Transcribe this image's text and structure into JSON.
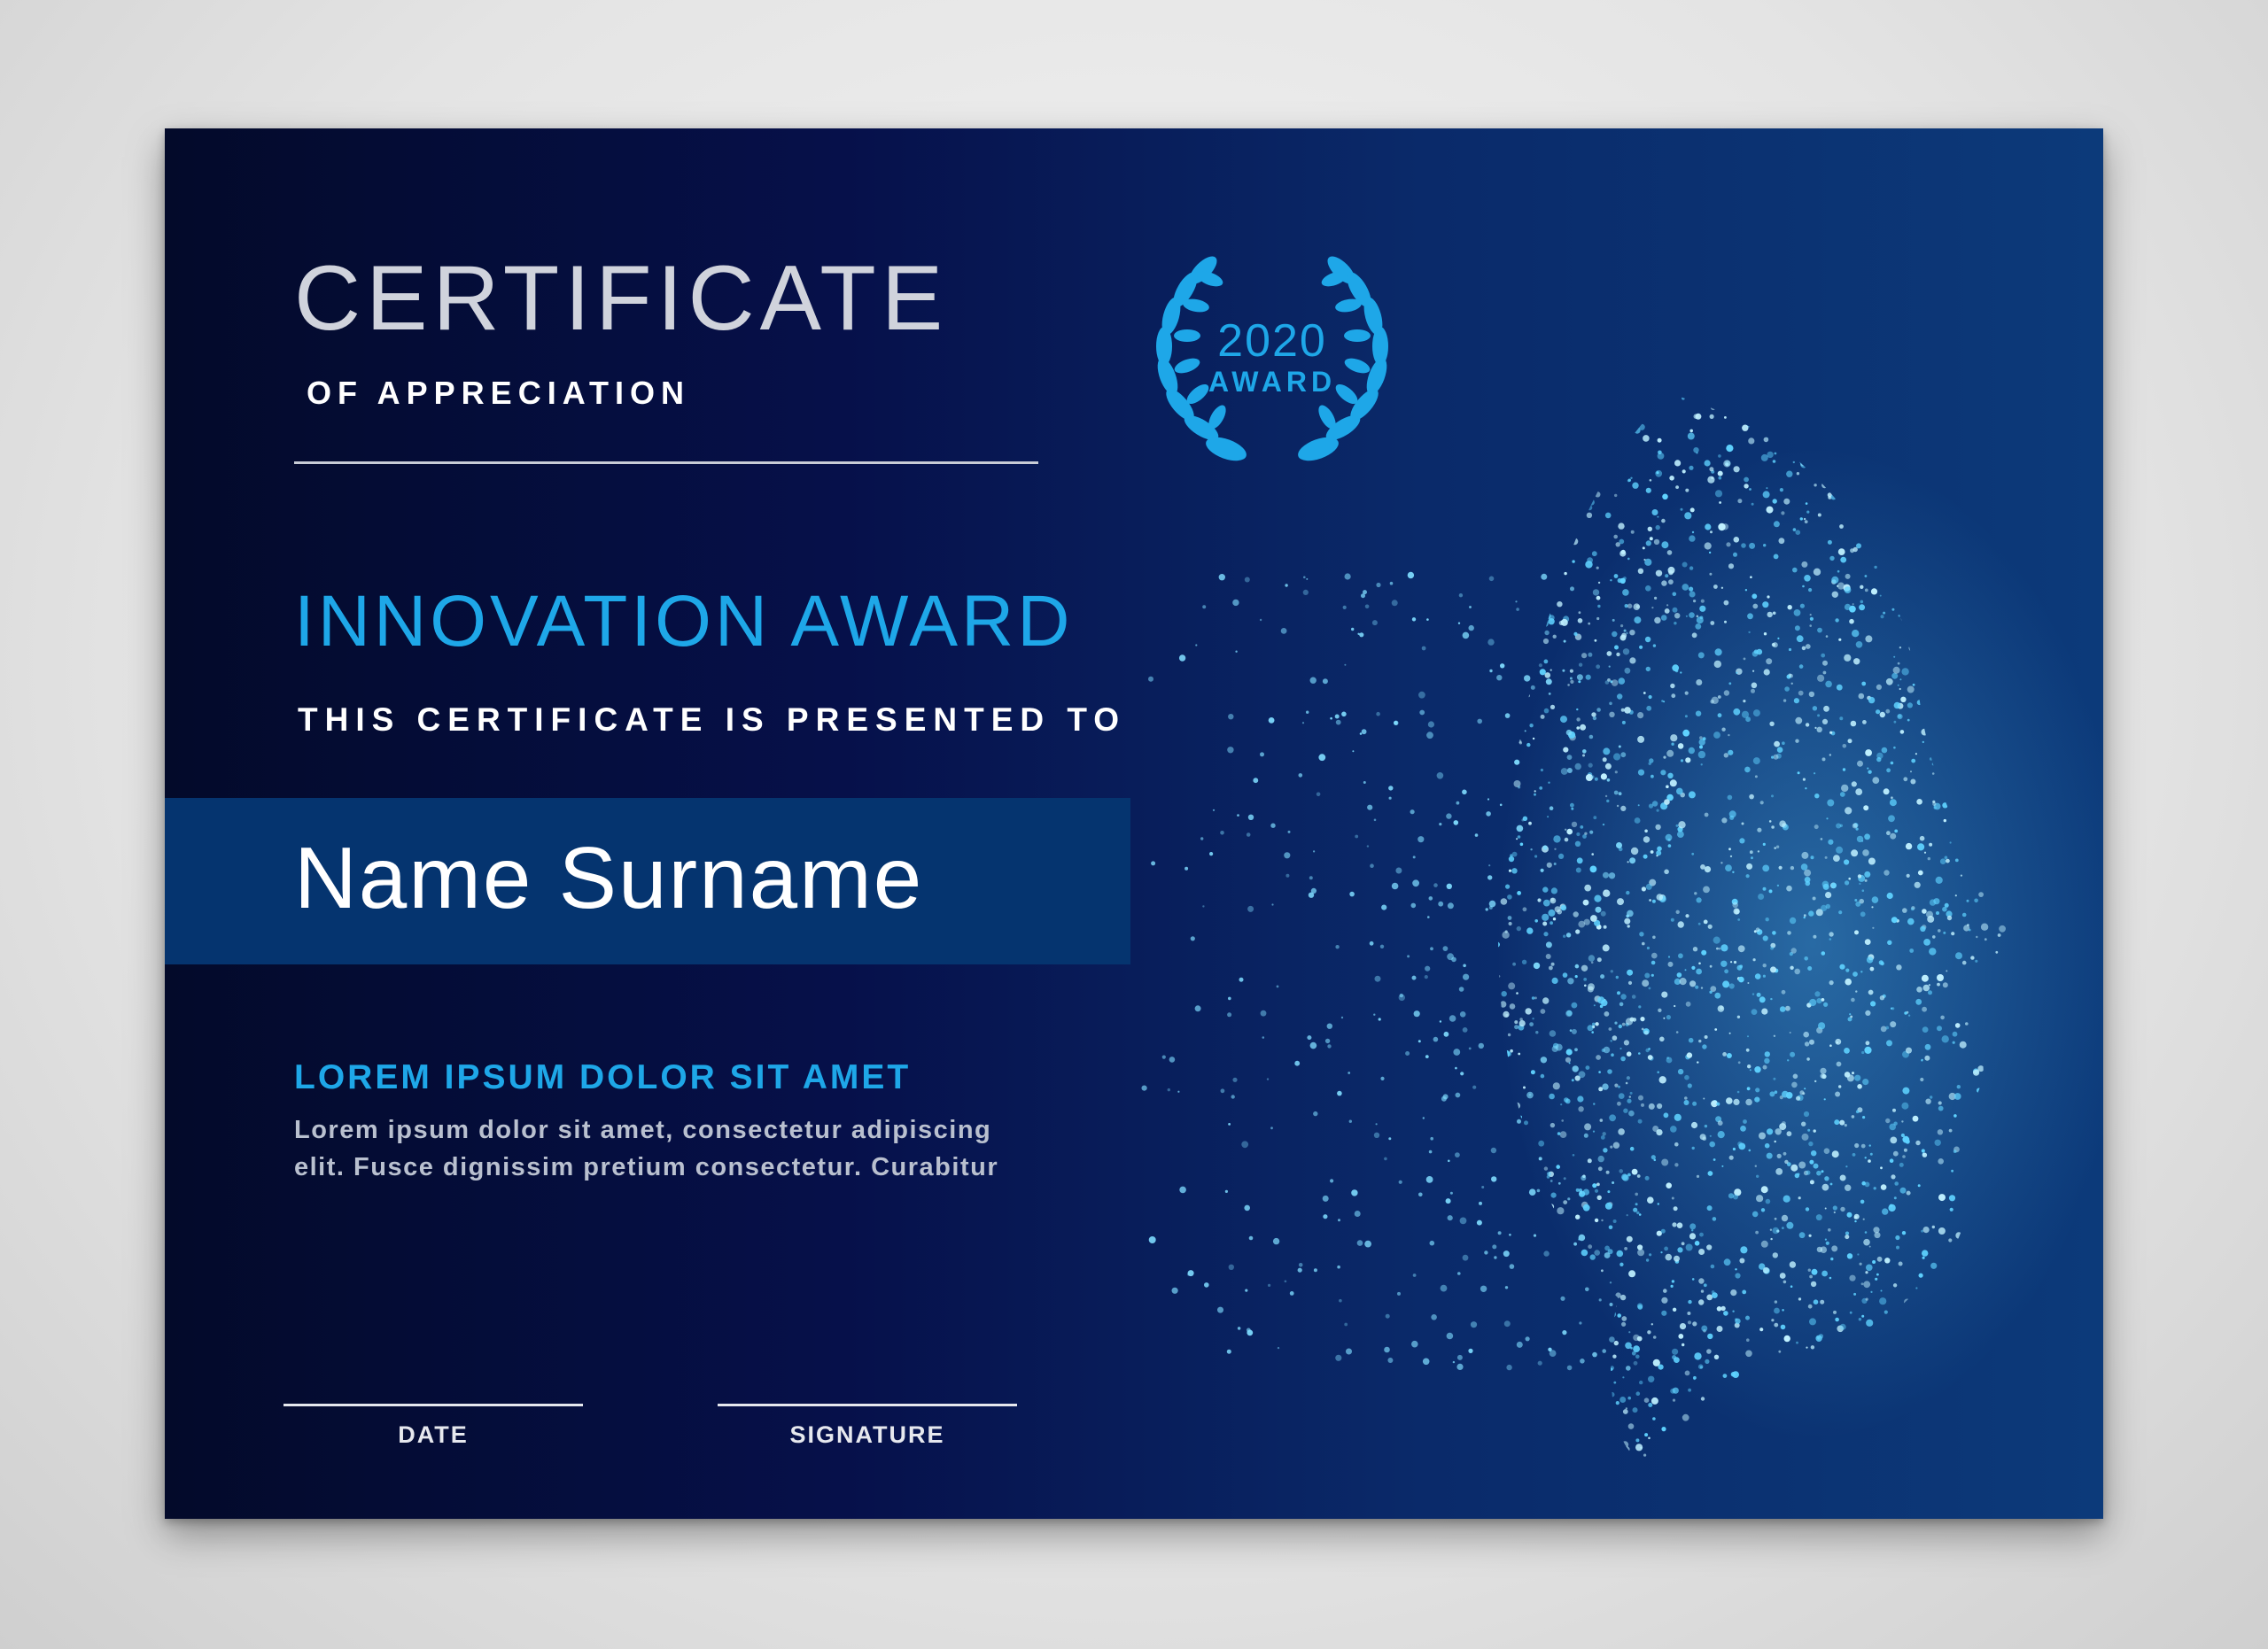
{
  "certificate": {
    "title": "CERTIFICATE",
    "subtitle": "OF APPRECIATION",
    "award_name": "INNOVATION AWARD",
    "presented_to": "THIS CERTIFICATE IS PRESENTED TO",
    "recipient_name": "Name Surname",
    "section_heading": "LOREM IPSUM DOLOR SIT AMET",
    "body_line_1": "Lorem ipsum dolor sit amet, consectetur adipiscing",
    "body_line_2": "elit. Fusce dignissim pretium consectetur. Curabitur",
    "date_label": "DATE",
    "signature_label": "SIGNATURE"
  },
  "seal": {
    "year": "2020",
    "label": "AWARD",
    "icon": "laurel-wreath-icon"
  },
  "illustration": {
    "icon": "particle-face-icon"
  },
  "colors": {
    "background_dark": "#030a2a",
    "background_light": "#0c3a7a",
    "accent": "#1ea7e8",
    "name_band": "#05346f",
    "title_text": "#d0d3dc"
  }
}
